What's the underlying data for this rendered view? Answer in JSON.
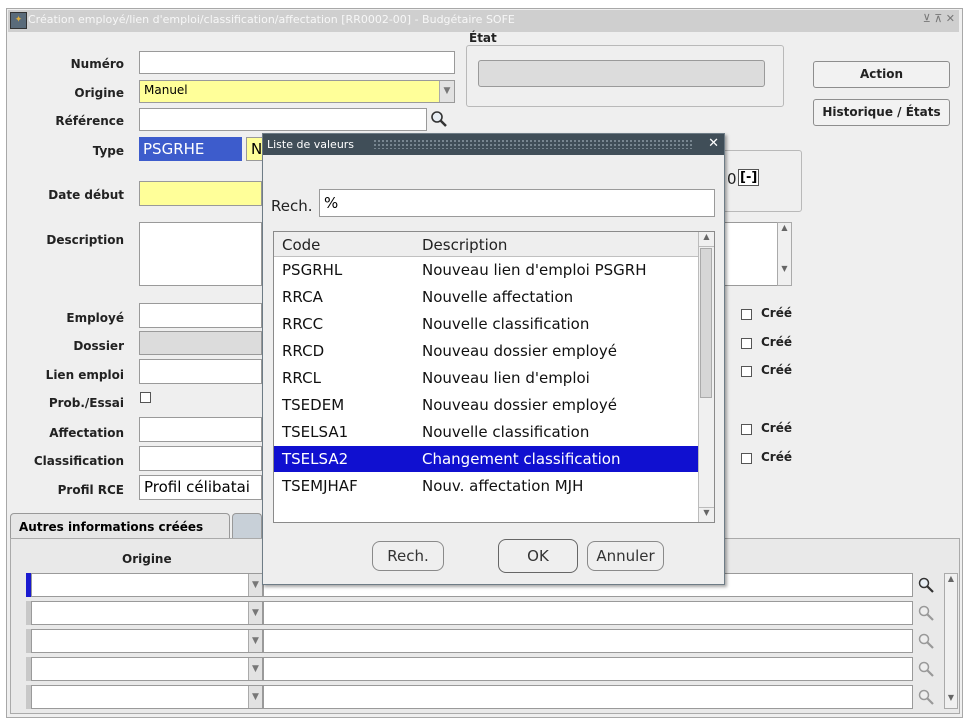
{
  "window": {
    "title": "Création employé/lien d'emploi/classification/affectation [RR0002-00] - Budgétaire SOFE"
  },
  "form": {
    "numero_label": "Numéro",
    "origine_label": "Origine",
    "origine_value": "Manuel",
    "reference_label": "Référence",
    "type_label": "Type",
    "type_value": "PSGRHE",
    "type_value2": "N",
    "date_debut_label": "Date début",
    "description_label": "Description",
    "employe_label": "Employé",
    "dossier_label": "Dossier",
    "lien_emploi_label": "Lien emploi",
    "prob_essai_label": "Prob./Essai",
    "affectation_label": "Affectation",
    "classification_label": "Classification",
    "profil_rce_label": "Profil RCE",
    "profil_rce_value": "Profil célibatai",
    "etat_label": "État",
    "counter_value": "0",
    "counter_btn": "[-]",
    "cree_label": "Créé"
  },
  "buttons": {
    "action": "Action",
    "historique": "Historique / États"
  },
  "tab": {
    "label": "Autres informations créées"
  },
  "grid": {
    "origine_header": "Origine"
  },
  "modal": {
    "title": "Liste de valeurs",
    "close": "✕",
    "search_label": "Rech.",
    "search_value": "%",
    "col_code": "Code",
    "col_description": "Description",
    "rows": [
      {
        "code": "PSGRHL",
        "description": "Nouveau lien d'emploi PSGRH"
      },
      {
        "code": "RRCA",
        "description": "Nouvelle affectation"
      },
      {
        "code": "RRCC",
        "description": "Nouvelle classification"
      },
      {
        "code": "RRCD",
        "description": "Nouveau dossier employé"
      },
      {
        "code": "RRCL",
        "description": "Nouveau lien d'emploi"
      },
      {
        "code": "TSEDEM",
        "description": "Nouveau dossier employé"
      },
      {
        "code": "TSELSA1",
        "description": "Nouvelle classification"
      },
      {
        "code": "TSELSA2",
        "description": "Changement classification"
      },
      {
        "code": "TSEMJHAF",
        "description": "Nouv. affectation MJH"
      }
    ],
    "selected_row": "TSELSA2",
    "btn_rech": "Rech.",
    "btn_ok": "OK",
    "btn_annuler": "Annuler"
  },
  "colors": {
    "selection": "#1010d0",
    "required_field": "#ffff99",
    "modal_title": "#404e58"
  }
}
